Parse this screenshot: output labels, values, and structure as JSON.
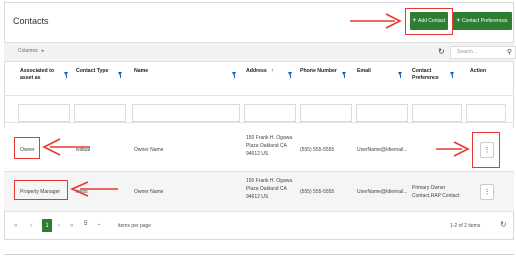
{
  "header": {
    "title": "Contacts",
    "add_label": "Add Contact",
    "pref_label": "Contact Preferences"
  },
  "toolbar": {
    "columns_label": "Columns",
    "columns_icon": "chevron-right-icon",
    "search_placeholder": "Search...",
    "refresh_icon": "refresh-icon",
    "search_icon": "search-icon"
  },
  "table": {
    "columns": [
      {
        "label": "Associated to asset as"
      },
      {
        "label": "Contact Type"
      },
      {
        "label": "Name"
      },
      {
        "label": "Address",
        "sort": "↑"
      },
      {
        "label": "Phone Number"
      },
      {
        "label": "Email"
      },
      {
        "label": "Contact Preference"
      },
      {
        "label": "Action"
      }
    ],
    "rows": [
      {
        "associated": "Owner",
        "type": "ividual",
        "name": "Owner Name",
        "address": "150 Frank H. Ogawa Plaza Oakland CA 94612 US",
        "phone": "(555) 555-5555",
        "email": "UserName@Idiemail...",
        "preference": "",
        "action": "⋮"
      },
      {
        "associated": "Property Manager",
        "type": "iness",
        "name": "Owner Name",
        "address": "150 Frank H. Ogawa Plaza Oakland CA 94612 US",
        "phone": "(555) 555-5555",
        "email": "UserName@Idiemail...",
        "preference": "Primary Owner Contact,RAP Contact",
        "action": "⋮"
      }
    ]
  },
  "pagination": {
    "first": "«",
    "prev": "‹",
    "current_page": "1",
    "next": "›",
    "last": "»",
    "page_size": "5",
    "per_page_label": "items per page",
    "count": "1-2 of 2 items"
  },
  "colors": {
    "accent": "#2e7d32",
    "filter_icon": "#1565c0",
    "callout": "#e53935"
  }
}
